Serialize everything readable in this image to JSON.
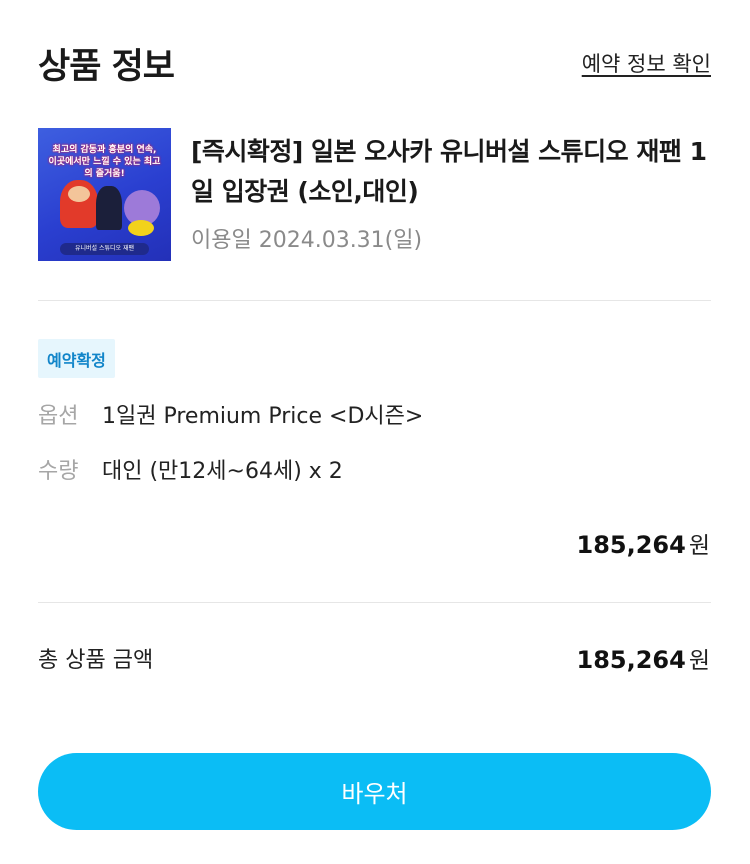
{
  "header": {
    "title": "상품 정보",
    "link_label": "예약 정보 확인"
  },
  "product": {
    "thumbnail": {
      "icon": "product-thumbnail",
      "ribbon": "최고의 감동과 흥분의 연속, 이곳에서만 느낄 수 있는 최고의 즐거움!",
      "footer": "유니버설 스튜디오 재팬",
      "colors": {
        "background": "#2a3fd0"
      }
    },
    "name": "[즉시확정] 일본 오사카 유니버설 스튜디오 재팬 1일 입장권 (소인,대인)",
    "use_date": "이용일 2024.03.31(일)"
  },
  "reservation": {
    "badge": "예약확정",
    "option_label": "옵션",
    "option_value": "1일권 Premium Price <D시즌>",
    "quantity_label": "수량",
    "quantity_value": "대인 (만12세~64세) x 2",
    "price": "185,264",
    "price_unit": "원"
  },
  "total": {
    "label": "총 상품 금액",
    "amount": "185,264",
    "unit": "원"
  },
  "voucher_button": {
    "label": "바우처"
  },
  "colors": {
    "accent": "#0bbdf5",
    "badge_bg": "#e6f6fd",
    "badge_text": "#1185c9"
  }
}
